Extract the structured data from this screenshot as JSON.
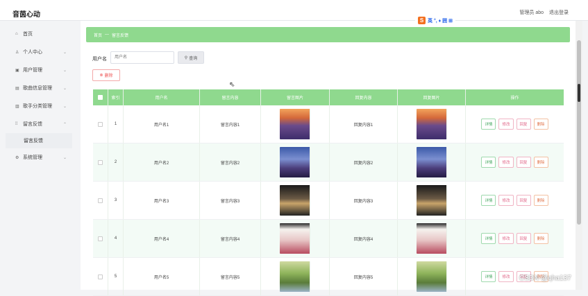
{
  "app": {
    "title": "音茵心动"
  },
  "topbar": {
    "admin": "管理员 abo",
    "logout": "退出登录"
  },
  "ime": {
    "logo": "S",
    "tools": "英 °, ♦ 囲 ⊞"
  },
  "sidebar": {
    "items": [
      {
        "label": "首页",
        "icon": "home-icon"
      },
      {
        "label": "个人中心",
        "icon": "user-icon"
      },
      {
        "label": "用户管理",
        "icon": "users-icon"
      },
      {
        "label": "歌曲信息管理",
        "icon": "music-icon"
      },
      {
        "label": "歌手分类管理",
        "icon": "category-icon"
      },
      {
        "label": "留言反馈",
        "icon": "message-icon"
      },
      {
        "label": "系统管理",
        "icon": "settings-icon"
      }
    ],
    "sub": "留言反馈"
  },
  "breadcrumb": {
    "home": "首页",
    "sep": "—",
    "current": "留言反馈"
  },
  "search": {
    "label": "用户名",
    "placeholder": "用户名",
    "button": "查询"
  },
  "actions": {
    "delete": "删除"
  },
  "table": {
    "headers": [
      "索引",
      "用户名",
      "留言内容",
      "留言图片",
      "回复内容",
      "回复图片",
      "操作"
    ],
    "rows": [
      {
        "idx": "1",
        "user": "用户名1",
        "content": "留言内容1",
        "img": "sunset",
        "reply": "回复内容1",
        "rimg": "sunset"
      },
      {
        "idx": "2",
        "user": "用户名2",
        "content": "留言内容2",
        "img": "pier",
        "reply": "回复内容2",
        "rimg": "pier"
      },
      {
        "idx": "3",
        "user": "用户名3",
        "content": "留言内容3",
        "img": "tree",
        "reply": "回复内容3",
        "rimg": "tree"
      },
      {
        "idx": "4",
        "user": "用户名4",
        "content": "留言内容4",
        "img": "room",
        "reply": "回复内容4",
        "rimg": "room"
      },
      {
        "idx": "5",
        "user": "用户名5",
        "content": "留言内容5",
        "img": "river",
        "reply": "回复内容5",
        "rimg": "river"
      }
    ],
    "ops": {
      "detail": "详情",
      "edit": "修改",
      "reply": "回复",
      "delete": "删除"
    }
  },
  "watermark": "CSDN @qha137"
}
